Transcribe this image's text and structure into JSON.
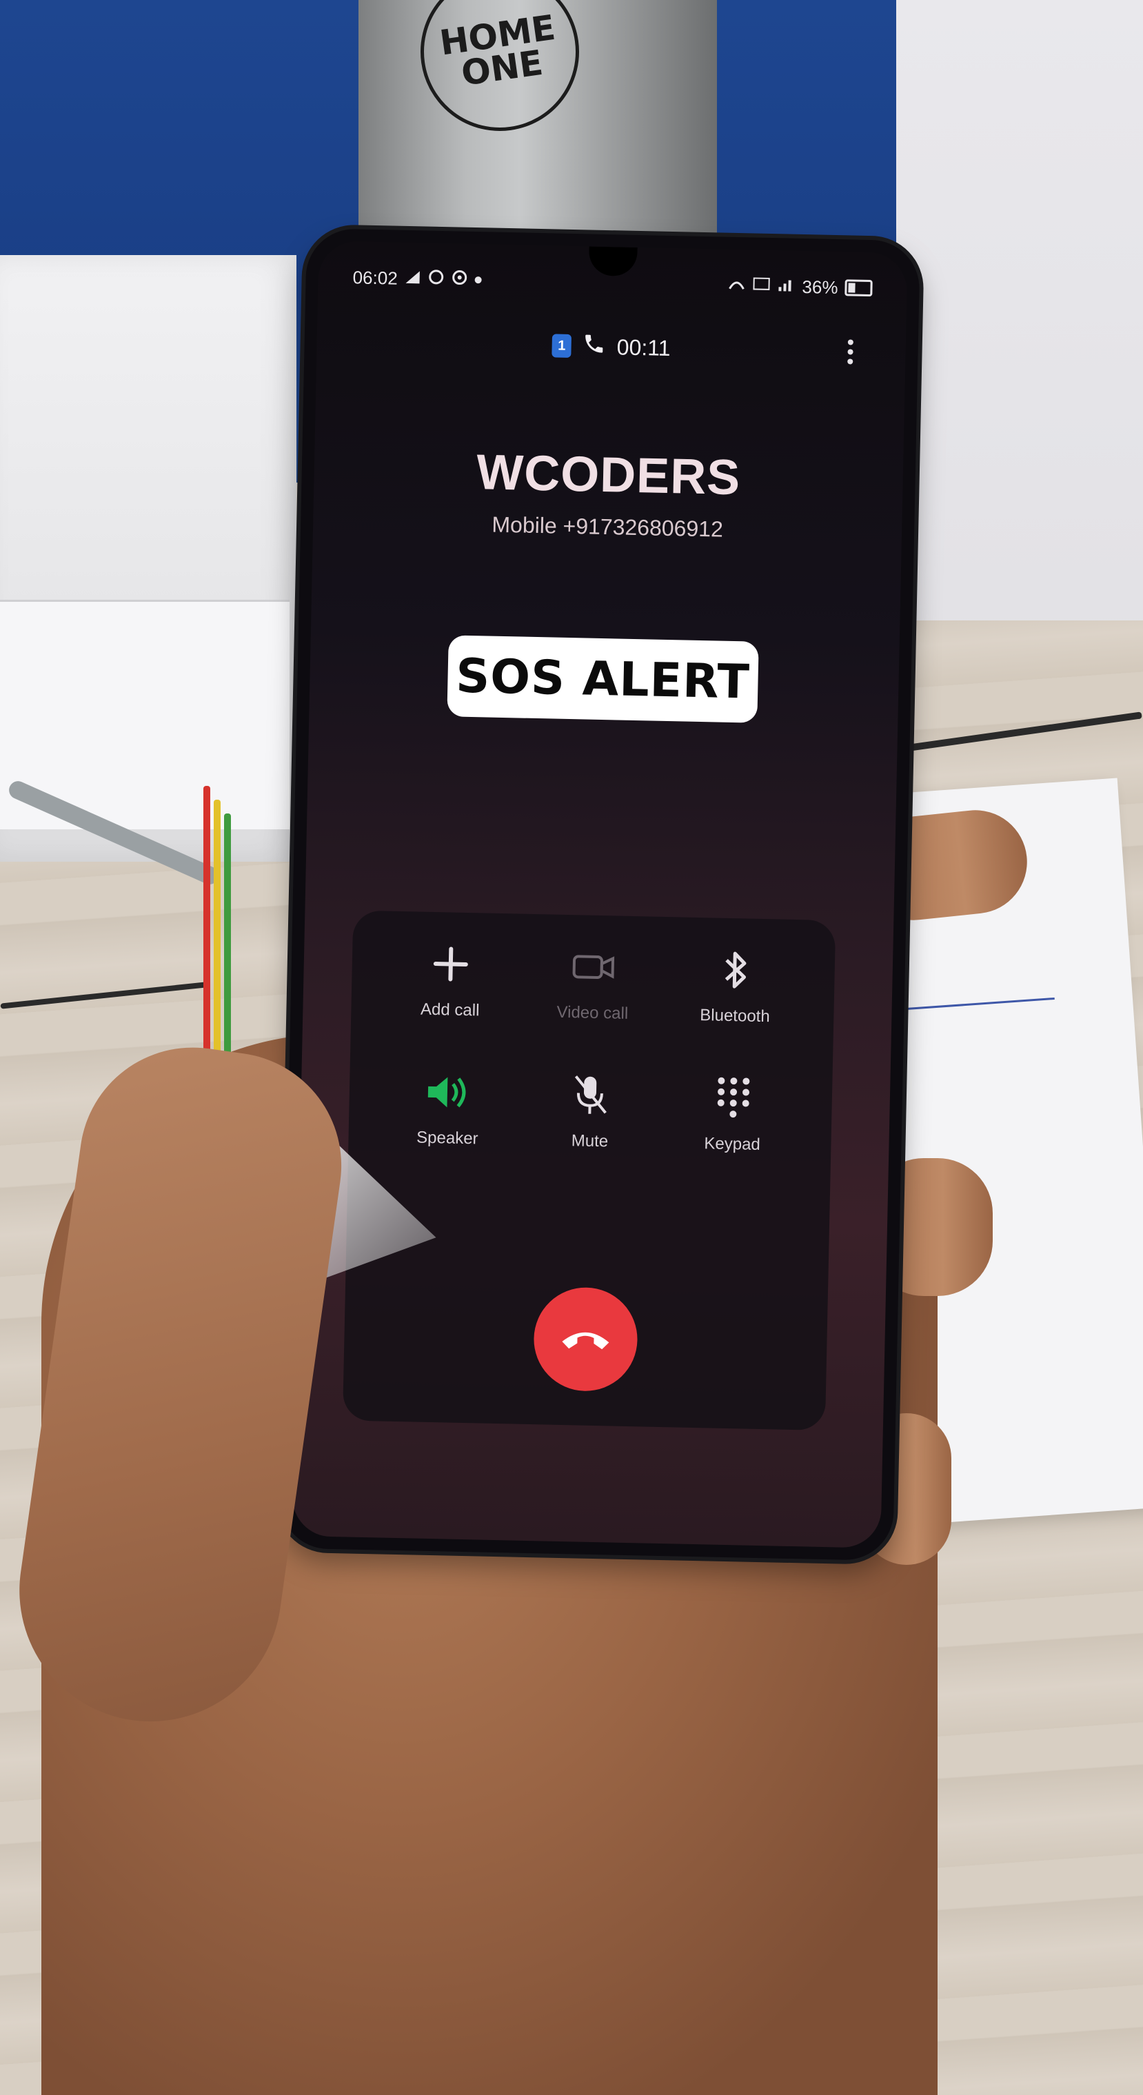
{
  "bottle_logo": {
    "line1": "HOME",
    "line2": "ONE"
  },
  "status_bar": {
    "time": "06:02",
    "battery": "36%"
  },
  "call": {
    "sim": "1",
    "duration": "00:11",
    "caller_name": "WCODERS",
    "caller_number": "Mobile +917326806912"
  },
  "overlay": {
    "label": "SOS ALERT"
  },
  "controls": [
    {
      "label": "Add call",
      "icon": "plus-icon",
      "state": "enabled"
    },
    {
      "label": "Video call",
      "icon": "video-icon",
      "state": "disabled"
    },
    {
      "label": "Bluetooth",
      "icon": "bluetooth-icon",
      "state": "enabled"
    },
    {
      "label": "Speaker",
      "icon": "speaker-icon",
      "state": "active"
    },
    {
      "label": "Mute",
      "icon": "mute-icon",
      "state": "enabled"
    },
    {
      "label": "Keypad",
      "icon": "keypad-icon",
      "state": "enabled"
    }
  ],
  "colors": {
    "end_call": "#e9393e",
    "speaker_active": "#1fb85a",
    "sim_badge": "#2d6fd6"
  }
}
